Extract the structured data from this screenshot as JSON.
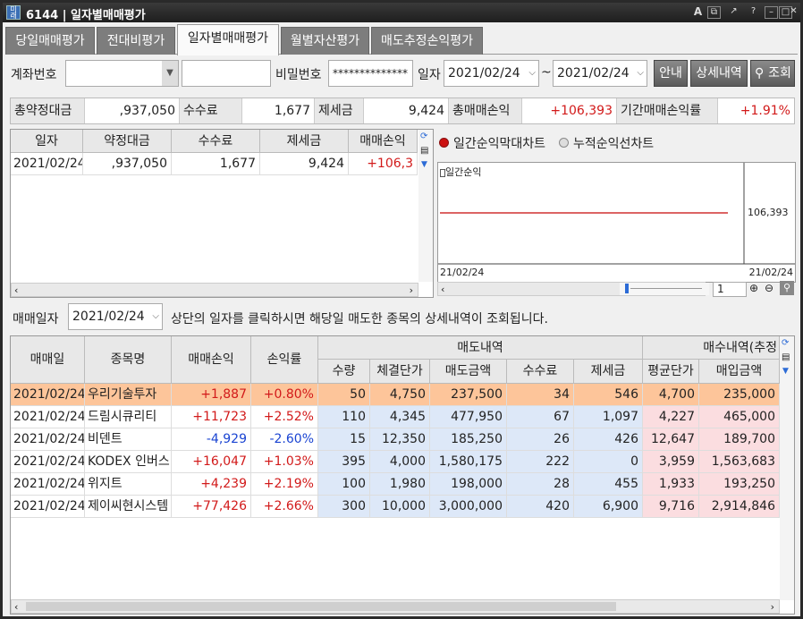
{
  "window": {
    "title": "6144 | 일자별매매평가",
    "app_icon_label": "미래"
  },
  "tabs": [
    "당일매매평가",
    "전대비평가",
    "일자별매매평가",
    "월별자산평가",
    "매도추정손익평가"
  ],
  "search": {
    "account_label": "계좌번호",
    "password_label": "비밀번호",
    "password_value": "**************",
    "date_label": "일자",
    "date_from": "2021/02/24",
    "tilde": "~",
    "date_to": "2021/02/24",
    "guide_button": "안내",
    "detail_button": "상세내역",
    "query_button": "조회"
  },
  "summary": {
    "total_contract_label": "총약정대금",
    "total_contract_value": ",937,050",
    "fee_label": "수수료",
    "fee_value": "1,677",
    "tax_label": "제세금",
    "tax_value": "9,424",
    "total_pl_label": "총매매손익",
    "total_pl_value": "+106,393",
    "period_rate_label": "기간매매손익률",
    "period_rate_value": "+1.91%"
  },
  "daily_table": {
    "headers": [
      "일자",
      "약정대금",
      "수수료",
      "제세금",
      "매매손익"
    ],
    "rows": [
      [
        "2021/02/24",
        ",937,050",
        "1,677",
        "9,424",
        "+106,3"
      ]
    ]
  },
  "chart_panel": {
    "radio_bar": "일간순익막대차트",
    "radio_line": "누적순익선차트",
    "legend": "일간순익",
    "zoom_value": "1"
  },
  "chart_data": {
    "type": "line",
    "x": [
      "21/02/24",
      "21/02/24"
    ],
    "x_tick_labels": [
      "21/02/24",
      "21/02/24"
    ],
    "series": [
      {
        "name": "일간순익",
        "values": [
          106393,
          106393
        ],
        "color": "#d03030"
      }
    ],
    "value_label": "106,393"
  },
  "detail": {
    "trade_date_label": "매매일자",
    "trade_date_value": "2021/02/24",
    "notice": "상단의 일자를 클릭하시면 해당일 매도한 종목의 상세내역이 조회됩니다.",
    "group_sell": "매도내역",
    "group_buy": "매수내역(추정",
    "headers": [
      "매매일",
      "종목명",
      "매매손익",
      "손익률",
      "수량",
      "체결단가",
      "매도금액",
      "수수료",
      "제세금",
      "평균단가",
      "매입금액"
    ],
    "rows": [
      [
        "2021/02/24",
        "우리기술투자",
        "+1,887",
        "+0.80%",
        "50",
        "4,750",
        "237,500",
        "34",
        "546",
        "4,700",
        "235,000"
      ],
      [
        "2021/02/24",
        "드림시큐리티",
        "+11,723",
        "+2.52%",
        "110",
        "4,345",
        "477,950",
        "67",
        "1,097",
        "4,227",
        "465,000"
      ],
      [
        "2021/02/24",
        "비덴트",
        "-4,929",
        "-2.60%",
        "15",
        "12,350",
        "185,250",
        "26",
        "426",
        "12,647",
        "189,700"
      ],
      [
        "2021/02/24",
        "KODEX 인버스",
        "+16,047",
        "+1.03%",
        "395",
        "4,000",
        "1,580,175",
        "222",
        "0",
        "3,959",
        "1,563,683"
      ],
      [
        "2021/02/24",
        "위지트",
        "+4,239",
        "+2.19%",
        "100",
        "1,980",
        "198,000",
        "28",
        "455",
        "1,933",
        "193,250"
      ],
      [
        "2021/02/24",
        "제이씨현시스템",
        "+77,426",
        "+2.66%",
        "300",
        "10,000",
        "3,000,000",
        "420",
        "6,900",
        "9,716",
        "2,914,846"
      ]
    ]
  },
  "colors": {
    "selected_row": "#fdc59a",
    "sell_block": "#dde8f8",
    "buy_block": "#fbdde0",
    "profit": "#d21a1a",
    "loss": "#1a44d2"
  }
}
